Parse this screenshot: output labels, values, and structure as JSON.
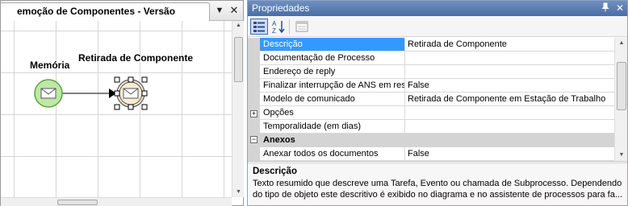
{
  "diagram": {
    "tab_title": "emoção de Componentes - Versão",
    "nodes": [
      {
        "label": "Memória"
      },
      {
        "label": "Retirada de Componente"
      }
    ]
  },
  "properties": {
    "title": "Propriedades",
    "rows": [
      {
        "name": "Descrição",
        "value": "Retirada de Componente",
        "selected": true
      },
      {
        "name": "Documentação de Processo",
        "value": ""
      },
      {
        "name": "Endereço de reply",
        "value": ""
      },
      {
        "name": "Finalizar interrupção de ANS em resp",
        "value": "False"
      },
      {
        "name": "Modelo de comunicado",
        "value": "Retirada de Componente em Estação de Trabalho"
      },
      {
        "name": "Opções",
        "value": "",
        "expander": "+"
      },
      {
        "name": "Temporalidade (em dias)",
        "value": ""
      }
    ],
    "category": {
      "name": "Anexos",
      "expander": "−"
    },
    "category_rows": [
      {
        "name": "Anexar todos os documentos",
        "value": "False"
      }
    ],
    "description": {
      "title": "Descrição",
      "text": "Texto resumido que descreve uma Tarefa, Evento ou chamada de Subprocesso. Dependendo\ndo tipo de objeto este descritivo é exibido no diagrama e no assistente de processos para fa..."
    }
  },
  "icons": {
    "dropdown": "dropdown-arrow-icon",
    "close": "close-icon",
    "pin": "pin-icon",
    "categorized": "categorized-icon",
    "alphabetical": "alphabetical-sort-icon",
    "property_pages": "property-pages-icon",
    "envelope": "envelope-icon"
  },
  "colors": {
    "start_event_fill": "#bfe8a6",
    "start_event_stroke": "#5aa63f",
    "intermediate_fill": "#f7ecd6",
    "selection_blue": "#3399ff",
    "title_bar": "#4a6ea5"
  }
}
